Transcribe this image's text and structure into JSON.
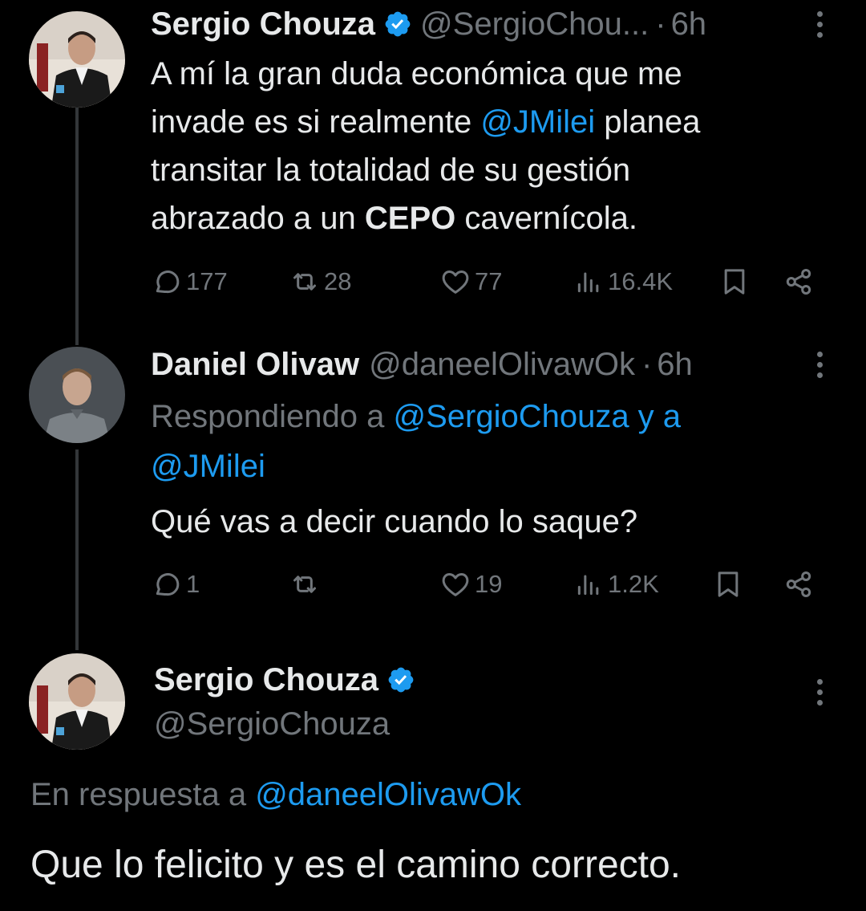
{
  "tweet1": {
    "name": "Sergio Chouza",
    "handle": "@SergioChou...",
    "sep": "·",
    "time": "6h",
    "line1": "A mí la gran duda económica que me",
    "line2_pre": "invade es si realmente ",
    "line2_mention": "@JMilei",
    "line2_post": " planea",
    "line3": "transitar la totalidad de su gestión",
    "line4_pre": "abrazado a un ",
    "line4_bold": "CEPO",
    "line4_post": " cavernícola.",
    "replies": "177",
    "retweets": "28",
    "likes": "77",
    "views": "16.4K"
  },
  "tweet2": {
    "name": "Daniel Olivaw",
    "handle": "@daneelOlivawOk",
    "sep": "·",
    "time": "6h",
    "replying_pre": "Respondiendo a ",
    "replying_mention1": "@SergioChouza y a",
    "replying_mention2": "@JMilei",
    "text": "Qué vas a decir cuando lo saque?",
    "replies": "1",
    "retweets": "",
    "likes": "19",
    "views": "1.2K"
  },
  "tweet3": {
    "name": "Sergio Chouza",
    "handle": "@SergioChouza",
    "in_reply_pre": "En respuesta a ",
    "in_reply_mention": "@daneelOlivawOk",
    "text": "Que lo felicito y es el camino correcto."
  },
  "icons": {
    "reply": "reply-icon",
    "retweet": "retweet-icon",
    "like": "heart-icon",
    "views": "views-icon",
    "bookmark": "bookmark-icon",
    "share": "share-icon",
    "verified": "verified-badge-icon",
    "more": "more-vertical-icon"
  },
  "colors": {
    "background": "#000000",
    "text": "#e7e9ea",
    "muted": "#71767b",
    "link": "#1d9bf0",
    "verified": "#1d9bf0"
  }
}
